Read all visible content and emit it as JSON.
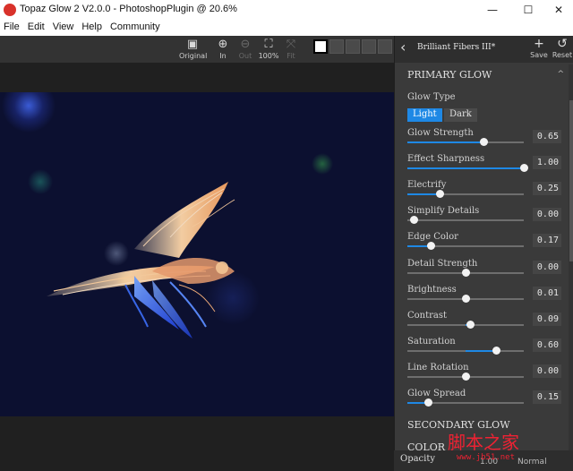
{
  "window": {
    "title": "Topaz Glow 2 V2.0.0 - PhotoshopPlugin @ 20.6%",
    "minimize_glyph": "—",
    "maximize_glyph": "☐",
    "close_glyph": "✕"
  },
  "menu": [
    "File",
    "Edit",
    "View",
    "Help",
    "Community"
  ],
  "toolbar": {
    "tools": [
      {
        "label": "Original",
        "icon": "image-icon",
        "glyph": "▣",
        "enabled": true
      },
      {
        "label": "In",
        "icon": "zoom-in-icon",
        "glyph": "⊕",
        "enabled": true
      },
      {
        "label": "Out",
        "icon": "zoom-out-icon",
        "glyph": "⊖",
        "enabled": false
      },
      {
        "label": "100%",
        "icon": "actual-size-icon",
        "glyph": "⛶",
        "enabled": true
      },
      {
        "label": "Fit",
        "icon": "fit-icon",
        "glyph": "⤧",
        "enabled": false
      }
    ]
  },
  "sidebar": {
    "back_glyph": "‹",
    "preset_name": "Brilliant Fibers III*",
    "save_label": "Save",
    "save_glyph": "+",
    "reset_label": "Reset",
    "reset_glyph": "↺",
    "primary_title": "PRIMARY GLOW",
    "glow_type_label": "Glow Type",
    "glow_type_light": "Light",
    "glow_type_dark": "Dark",
    "sliders": [
      {
        "label": "Glow Strength",
        "value": "0.65",
        "pos": 0.65,
        "fill_from": 0
      },
      {
        "label": "Effect Sharpness",
        "value": "1.00",
        "pos": 1.0,
        "fill_from": 0
      },
      {
        "label": "Electrify",
        "value": "0.25",
        "pos": 0.28,
        "fill_from": 0
      },
      {
        "label": "Simplify Details",
        "value": "0.00",
        "pos": 0.05,
        "fill_from": 0.05
      },
      {
        "label": "Edge Color",
        "value": "0.17",
        "pos": 0.2,
        "fill_from": 0
      },
      {
        "label": "Detail Strength",
        "value": "0.00",
        "pos": 0.5,
        "fill_from": 0.5
      },
      {
        "label": "Brightness",
        "value": "0.01",
        "pos": 0.5,
        "fill_from": 0.5
      },
      {
        "label": "Contrast",
        "value": "0.09",
        "pos": 0.54,
        "fill_from": 0.5
      },
      {
        "label": "Saturation",
        "value": "0.60",
        "pos": 0.76,
        "fill_from": 0.5
      },
      {
        "label": "Line Rotation",
        "value": "0.00",
        "pos": 0.5,
        "fill_from": 0.5
      },
      {
        "label": "Glow Spread",
        "value": "0.15",
        "pos": 0.18,
        "fill_from": 0
      }
    ],
    "secondary_title": "SECONDARY GLOW",
    "color_title": "COLOR",
    "bottom_label": "Opacity",
    "bottom_value": "1.00",
    "bottom_mode": "Normal",
    "collapse_glyph": "^"
  },
  "watermark": {
    "text": "脚本之家",
    "url": "www.jb51.net"
  },
  "colors": {
    "accent": "#1e88e5",
    "panel": "#3a3a3a"
  }
}
